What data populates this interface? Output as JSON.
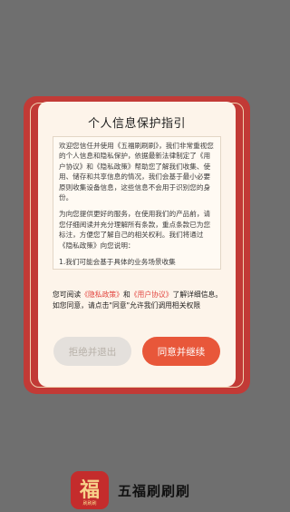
{
  "dialog": {
    "title": "个人信息保护指引",
    "paragraphs": [
      "欢迎您信任并使用《五福刷刷刷》，我们非常重视您的个人信息和隐私保护，依据最新法律制定了《用户协议》和《隐私政策》帮助您了解我们收集、使用、储存和共享信息的情况，我们会基于最小必要原则收集设备信息，这些信息不会用于识别您的身份。",
      "为向您提供更好的服务，在使用我们的产品前，请您仔细阅读并充分理解所有条款，重点条款已为您标注，方便您了解自己的相关权利。我们将通过《隐私政策》向您说明：",
      "1.我们可能会基于具体的业务场景收集"
    ],
    "notice_prefix": "您可阅读",
    "privacy_link": "《隐私政策》",
    "notice_and": "和",
    "agreement_link": "《用户协议》",
    "notice_suffix": "了解详细信息。如您同意，请点击\"同意\"允许我们调用相关权限",
    "reject_label": "拒绝并退出",
    "agree_label": "同意并继续"
  },
  "branding": {
    "logo_glyph": "福",
    "logo_subtext": "刷刷刷",
    "app_name": "五福刷刷刷"
  },
  "colors": {
    "accent": "#e8573a",
    "frame": "#c23a36",
    "link": "#e2453f",
    "overlay": "#6f6f6f"
  }
}
